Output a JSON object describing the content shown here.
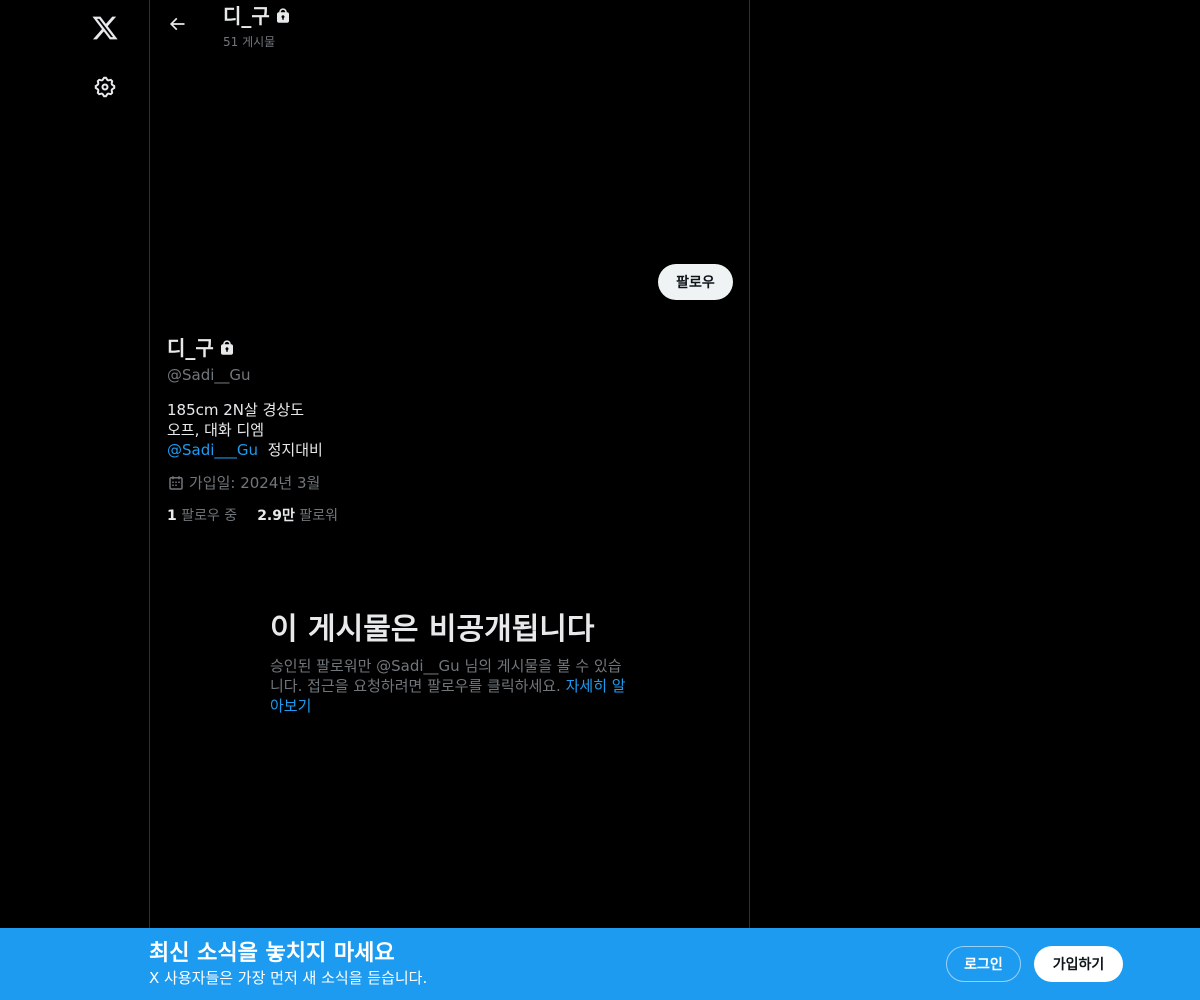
{
  "nav": {
    "logo_icon": "x-logo-icon",
    "settings_icon": "gear-icon"
  },
  "header": {
    "title": "디_구",
    "post_count": "51 게시물",
    "back_icon": "arrow-left-icon"
  },
  "profile": {
    "follow_button": "팔로우",
    "name": "디_구",
    "handle": "@Sadi__Gu",
    "bio": {
      "line1": "185cm 2N살 경상도",
      "line2": "오프, 대화 디엠",
      "mention": "@Sadi___Gu",
      "mention_suffix": "정지대비"
    },
    "joined": "가입일: 2024년 3월",
    "following_count": "1",
    "following_label": "팔로우 중",
    "followers_count": "2.9만",
    "followers_label": "팔로워"
  },
  "private_notice": {
    "title": "이 게시물은 비공개됩니다",
    "description": "승인된 팔로워만 @Sadi__Gu 님의 게시물을 볼 수 있습니다. 접근을 요청하려면 팔로우를 클릭하세요.",
    "learn_more": "자세히 알아보기"
  },
  "banner": {
    "title": "최신 소식을 놓치지 마세요",
    "subtitle": "X 사용자들은 가장 먼저 새 소식을 듣습니다.",
    "login_button": "로그인",
    "signup_button": "가입하기"
  },
  "colors": {
    "background": "#000000",
    "accent": "#1d9bf0",
    "text_primary": "#e7e9ea",
    "text_secondary": "#71767b",
    "border": "#2f3336"
  }
}
